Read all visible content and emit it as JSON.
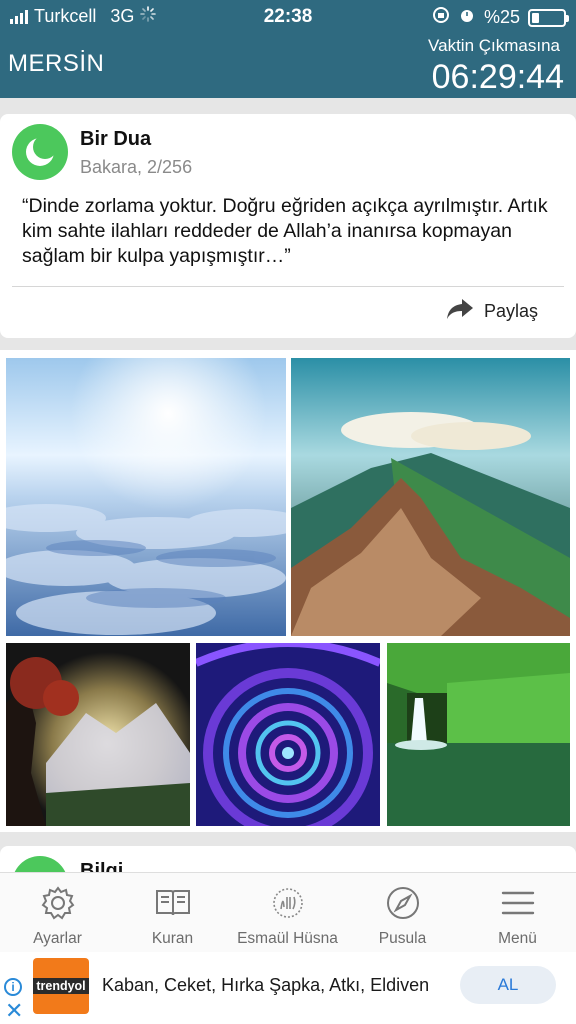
{
  "status_bar": {
    "carrier": "Turkcell",
    "network": "3G",
    "time": "22:38",
    "battery": "%25"
  },
  "header": {
    "city": "MERSİN",
    "remaining_label": "Vaktin Çıkmasına",
    "remaining_time": "06:29:44"
  },
  "card": {
    "title": "Bir Dua",
    "subtitle": "Bakara, 2/256",
    "quote": "“Dinde zorlama yoktur. Doğru eğriden açıkça ayrılmıştır. Artık kim sahte ilahları reddeder de Allah’a inanırsa kopmayan sağlam bir kulpa yapışmıştır…”",
    "share_label": "Paylaş"
  },
  "card2": {
    "title": "Bilgi"
  },
  "tabs": [
    {
      "label": "Ayarlar",
      "icon": "gear-icon"
    },
    {
      "label": "Kuran",
      "icon": "book-icon"
    },
    {
      "label": "Esmaül Hüsna",
      "icon": "calligraphy-icon"
    },
    {
      "label": "Pusula",
      "icon": "compass-icon"
    },
    {
      "label": "Menü",
      "icon": "menu-icon"
    }
  ],
  "ad": {
    "brand": "trendyol",
    "text": "Kaban, Ceket, Hırka Şapka, Atkı, Eldiven",
    "button": "AL"
  },
  "colors": {
    "header_bg": "#2f6a80",
    "accent_green": "#4cc85c",
    "ad_blue": "#2a8ad8"
  }
}
